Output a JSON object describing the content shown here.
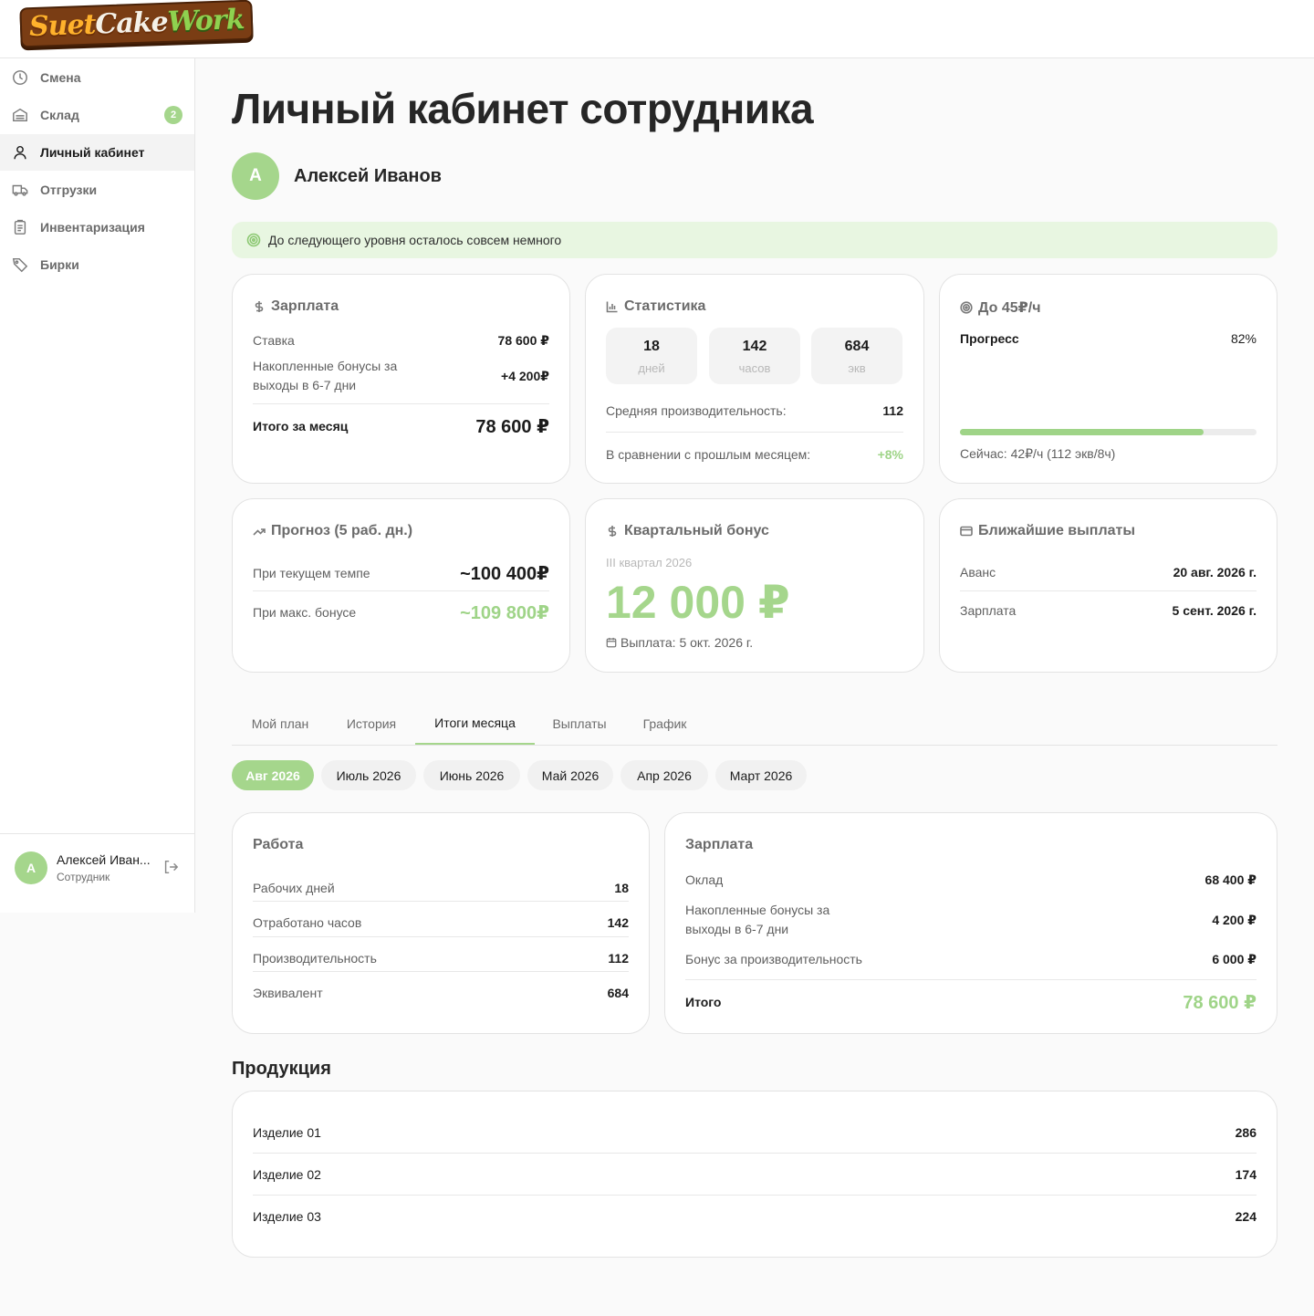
{
  "app": {
    "logo": {
      "part1": "Suet",
      "part2": "Cake",
      "part3": "Work"
    }
  },
  "sidebar": {
    "items": [
      {
        "label": "Смена",
        "icon": "clock-icon"
      },
      {
        "label": "Склад",
        "icon": "warehouse-icon",
        "badge": "2"
      },
      {
        "label": "Личный кабинет",
        "icon": "user-icon",
        "active": true
      },
      {
        "label": "Отгрузки",
        "icon": "truck-icon"
      },
      {
        "label": "Инвентаризация",
        "icon": "clipboard-icon"
      },
      {
        "label": "Бирки",
        "icon": "tag-icon"
      }
    ],
    "footer": {
      "avatar": "А",
      "name": "Алексей Иван...",
      "role": "Сотрудник"
    }
  },
  "page": {
    "title": "Личный кабинет сотрудника",
    "user": {
      "avatar": "А",
      "name": "Алексей Иванов"
    },
    "banner": "До следующего уровня осталось совсем немного"
  },
  "salary_card": {
    "title": "Зарплата",
    "rate_label": "Ставка",
    "rate_value": "78 600 ₽",
    "bonus_label_1": "Накопленные бонусы за",
    "bonus_label_2": "выходы в 6-7 дни",
    "bonus_value": "+4 200₽",
    "total_label": "Итого за месяц",
    "total_value": "78 600 ₽"
  },
  "stats_card": {
    "title": "Статистика",
    "boxes": [
      {
        "value": "18",
        "unit": "дней"
      },
      {
        "value": "142",
        "unit": "часов"
      },
      {
        "value": "684",
        "unit": "экв"
      }
    ],
    "avg_label": "Средняя производительность:",
    "avg_value": "112",
    "compare_label": "В сравнении с прошлым месяцем:",
    "compare_value": "+8%"
  },
  "goal_card": {
    "title": "До 45₽/ч",
    "progress_label": "Прогресс",
    "progress_value": "82%",
    "progress_fraction": 0.82,
    "current": "Сейчас: 42₽/ч (112 экв/8ч)"
  },
  "forecast_card": {
    "title": "Прогноз (5 раб. дн.)",
    "current_label": "При текущем темпе",
    "current_value": "~100 400₽",
    "max_label": "При макс. бонусе",
    "max_value": "~109 800₽"
  },
  "quarter_card": {
    "title": "Квартальный бонус",
    "period": "III квартал 2026",
    "amount": "12 000 ₽",
    "payout": "Выплата: 5 окт. 2026 г."
  },
  "payouts_card": {
    "title": "Ближайшие выплаты",
    "rows": [
      {
        "label": "Аванс",
        "value": "20 авг. 2026 г."
      },
      {
        "label": "Зарплата",
        "value": "5 сент. 2026 г."
      }
    ]
  },
  "tabs": [
    "Мой план",
    "История",
    "Итоги месяца",
    "Выплаты",
    "График"
  ],
  "active_tab": "Итоги месяца",
  "months": [
    "Авг 2026",
    "Июль 2026",
    "Июнь 2026",
    "Май 2026",
    "Апр 2026",
    "Март 2026"
  ],
  "active_month": "Авг 2026",
  "work_card": {
    "title": "Работа",
    "rows": [
      {
        "label": "Рабочих дней",
        "value": "18"
      },
      {
        "label": "Отработано часов",
        "value": "142"
      },
      {
        "label": "Производительность",
        "value": "112"
      },
      {
        "label": "Эквивалент",
        "value": "684"
      }
    ]
  },
  "salary_summary": {
    "title": "Зарплата",
    "base_label": "Оклад",
    "base_value": "68 400 ₽",
    "bonus_label_1": "Накопленные бонусы за",
    "bonus_label_2": "выходы в 6-7 дни",
    "bonus_value": "4 200 ₽",
    "perf_label": "Бонус за производительность",
    "perf_value": "6 000 ₽",
    "total_label": "Итого",
    "total_value": "78 600 ₽"
  },
  "products": {
    "title": "Продукция",
    "rows": [
      {
        "label": "Изделие 01",
        "value": "286"
      },
      {
        "label": "Изделие 02",
        "value": "174"
      },
      {
        "label": "Изделие 03",
        "value": "224"
      }
    ]
  }
}
